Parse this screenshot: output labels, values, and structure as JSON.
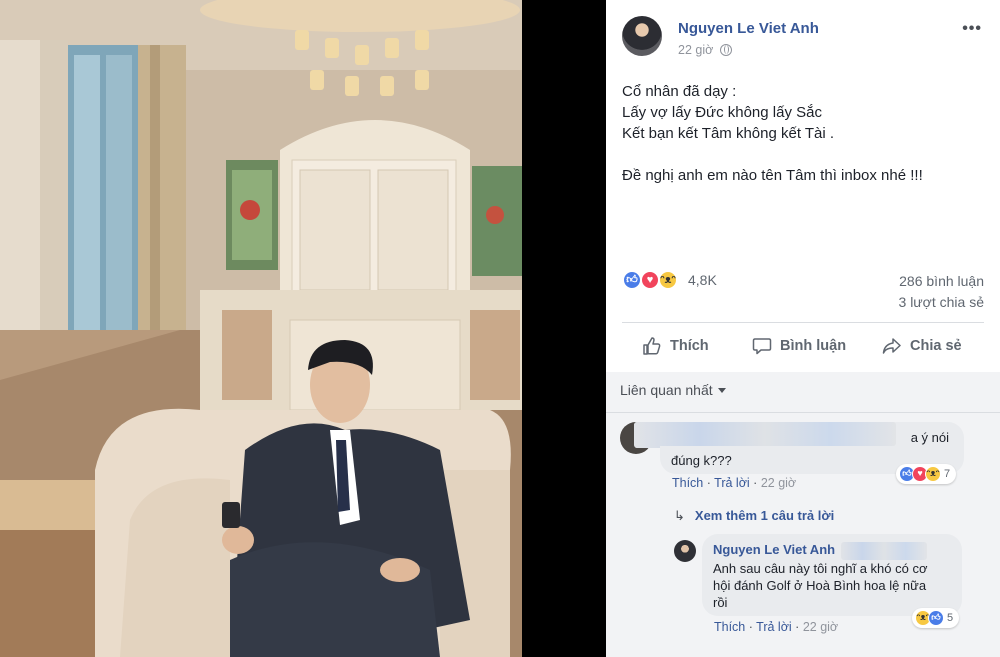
{
  "post": {
    "author": "Nguyen Le Viet Anh",
    "time": "22 giờ",
    "more_icon": "ellipsis-icon",
    "text_lines": [
      "Cổ nhân đã dạy :",
      "Lấy vợ lấy Đức không lấy Sắc",
      "Kết bạn kết Tâm không kết Tài .",
      "",
      "Đề nghị anh em nào tên Tâm thì inbox nhé !!!"
    ]
  },
  "reactions": {
    "types": [
      "like",
      "love",
      "haha"
    ],
    "count": "4,8K",
    "comments": "286 bình luận",
    "shares": "3 lượt chia sẻ"
  },
  "actions": {
    "like": "Thích",
    "comment": "Bình luận",
    "share": "Chia sẻ"
  },
  "comments_section": {
    "sort_label": "Liên quan nhất",
    "comment1": {
      "text_tail": "a ý nói",
      "text_line2": "đúng k???",
      "reaction_count": "7",
      "like": "Thích",
      "reply": "Trả lời",
      "time": "22 giờ"
    },
    "more_replies": "Xem thêm 1 câu trả lời",
    "reply1": {
      "author": "Nguyen Le Viet Anh",
      "text": "Anh sau câu này tôi nghĩ a khó có cơ hội đánh Golf ở Hoà Bình hoa lệ nữa rồi",
      "text_lines": [
        "Anh sau câu này tôi nghĩ a khó có cơ",
        "hội đánh Golf ở Hoà Bình hoa lệ nữa",
        "rồi"
      ],
      "reaction_count": "5",
      "like": "Thích",
      "reply": "Trả lời",
      "time": "22 giờ"
    }
  },
  "colors": {
    "link": "#385898",
    "like": "#4a7de8",
    "love": "#f1445c",
    "haha": "#f7c842",
    "panel_bg": "#ffffff",
    "comments_bg": "#f2f3f5"
  }
}
